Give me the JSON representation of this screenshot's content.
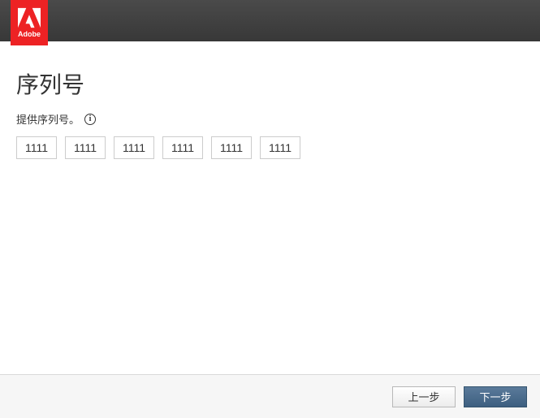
{
  "brand": {
    "name": "Adobe",
    "accent_color": "#ed2224"
  },
  "page": {
    "title": "序列号",
    "prompt": "提供序列号。",
    "info_glyph": "i"
  },
  "serial": {
    "fields": [
      "1111",
      "1111",
      "1111",
      "1111",
      "1111",
      "1111"
    ]
  },
  "footer": {
    "back_label": "上一步",
    "next_label": "下一步"
  }
}
